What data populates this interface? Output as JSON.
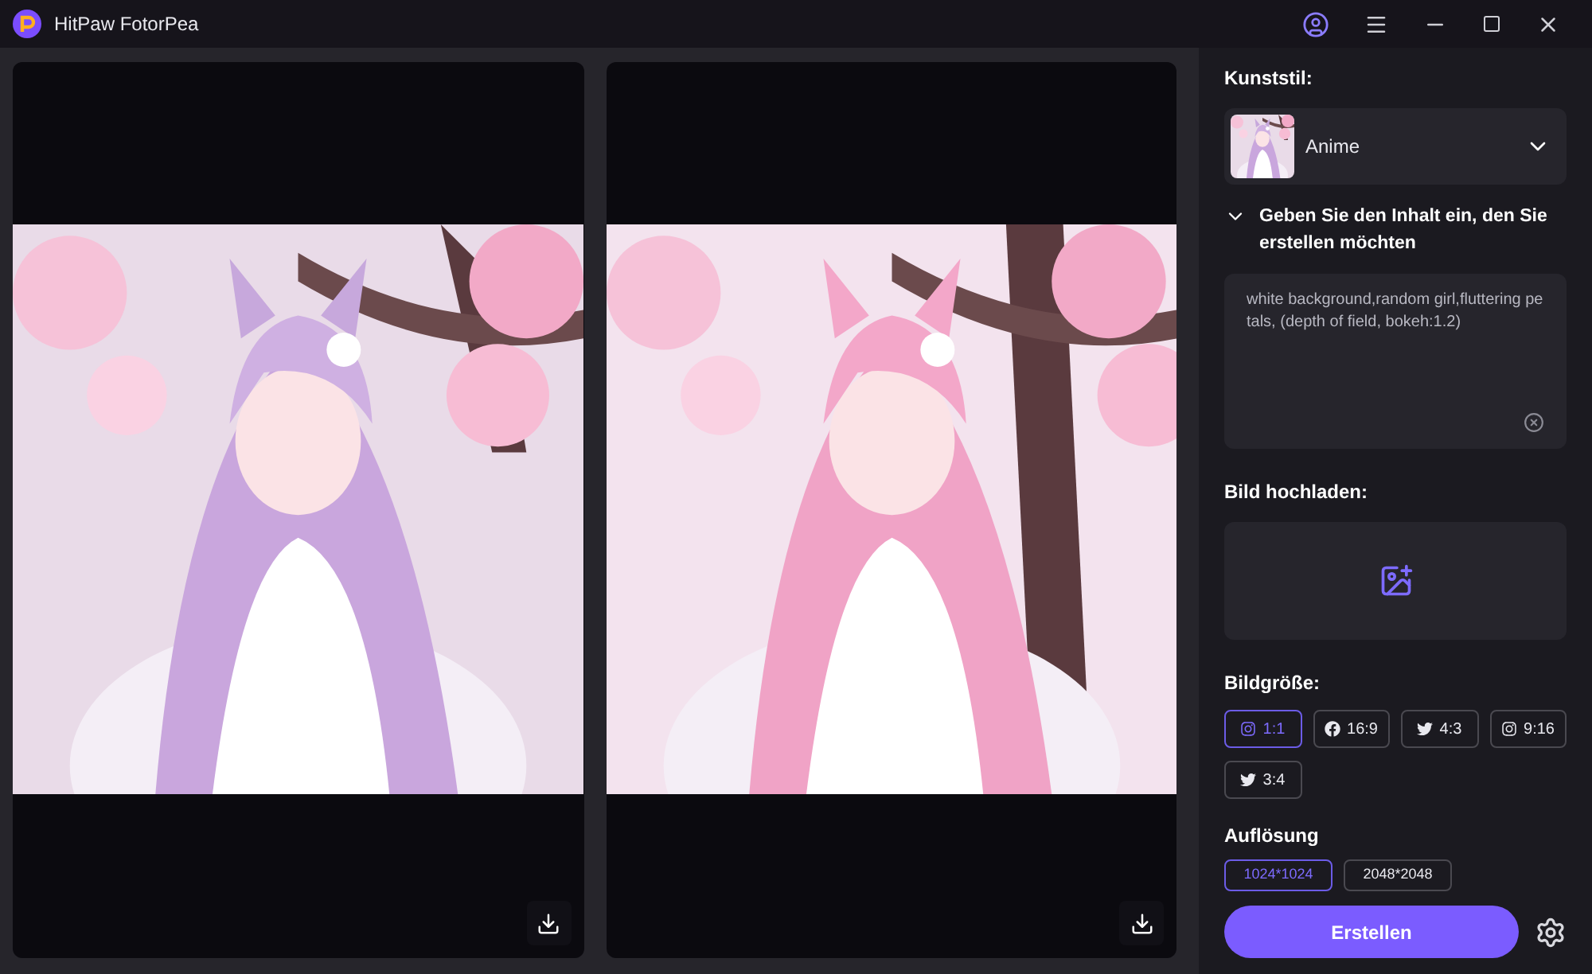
{
  "app": {
    "title": "HitPaw FotorPea"
  },
  "panel": {
    "style_label": "Kunststil:",
    "style_select": {
      "value": "Anime"
    },
    "prompt_section": {
      "title": "Geben Sie den Inhalt ein, den Sie erstellen möchten",
      "expanded": true
    },
    "prompt": {
      "value": "white background,random girl,fluttering petals, (depth of field, bokeh:1.2)"
    },
    "upload_label": "Bild hochladen:",
    "size_label": "Bildgröße:",
    "sizes": [
      {
        "label": "1:1",
        "kind": "instagram",
        "selected": true
      },
      {
        "label": "16:9",
        "kind": "facebook",
        "selected": false
      },
      {
        "label": "4:3",
        "kind": "twitter",
        "selected": false
      },
      {
        "label": "9:16",
        "kind": "instagram",
        "selected": false
      },
      {
        "label": "3:4",
        "kind": "twitter",
        "selected": false
      }
    ],
    "resolution_label": "Auflösung",
    "resolutions": [
      {
        "label": "1024*1024",
        "selected": true
      },
      {
        "label": "2048*2048",
        "selected": false
      }
    ],
    "create_button": "Erstellen"
  }
}
